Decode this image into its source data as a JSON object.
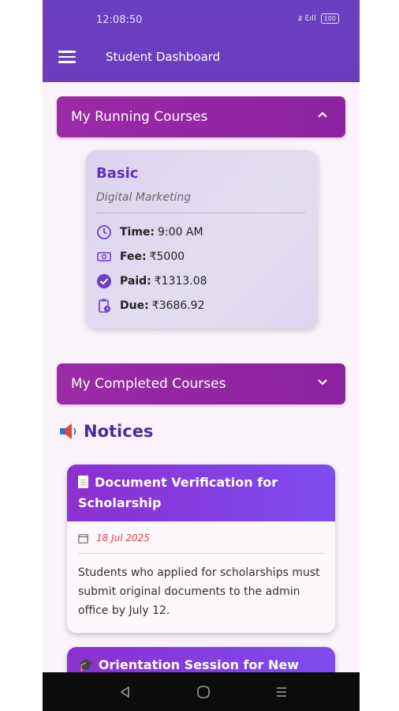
{
  "status_bar": {
    "time": "12:08:50",
    "signal_text": "ƶ ℇıll",
    "battery": "100"
  },
  "app_bar": {
    "title": "Student Dashboard"
  },
  "running_section": {
    "label": "My Running Courses"
  },
  "course": {
    "level": "Basic",
    "name": "Digital Marketing",
    "time_label": "Time:",
    "time_value": "9:00 AM",
    "fee_label": "Fee:",
    "fee_value": "₹5000",
    "paid_label": "Paid:",
    "paid_value": "₹1313.08",
    "due_label": "Due:",
    "due_value": "₹3686.92"
  },
  "completed_section": {
    "label": "My Completed Courses"
  },
  "notices": {
    "heading": "Notices",
    "items": [
      {
        "title": "Document Verification for Scholarship",
        "date": "18 Jul 2025",
        "body": "Students who applied for scholarships must submit original documents to the admin office by July 12."
      },
      {
        "title": "Orientation Session for New"
      }
    ]
  },
  "colors": {
    "appbar": "#6a3fc0",
    "section": "#9b2aa6",
    "accent": "#5e2fc1",
    "date": "#e0454a"
  }
}
